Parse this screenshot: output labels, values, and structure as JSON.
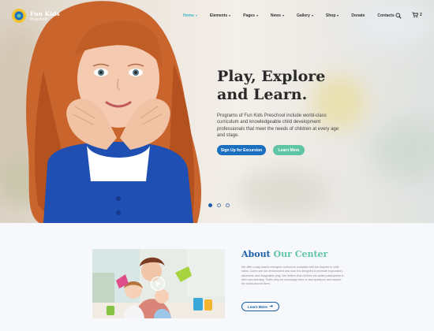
{
  "brand": {
    "name": "Fun Kids",
    "tagline": "Preschool"
  },
  "nav": {
    "items": [
      {
        "label": "Home",
        "dropdown": true,
        "active": true
      },
      {
        "label": "Elements",
        "dropdown": true
      },
      {
        "label": "Pages",
        "dropdown": true
      },
      {
        "label": "News",
        "dropdown": true
      },
      {
        "label": "Gallery",
        "dropdown": true
      },
      {
        "label": "Shop",
        "dropdown": true
      },
      {
        "label": "Donate",
        "dropdown": false
      },
      {
        "label": "Contacts",
        "dropdown": false
      }
    ],
    "search_icon": "search-icon",
    "cart_icon": "cart-icon",
    "cart_count": "2"
  },
  "hero": {
    "title": "Play, Explore and Learn.",
    "description": "Programs of Fun Kids Preschool include world-class curriculum and knowledgeable child development professionals that meet the needs of children at every age and stage.",
    "primary_button": "Sign Up for Excursion",
    "secondary_button": "Learn More",
    "slides": 3,
    "active_slide": 1
  },
  "about": {
    "title_part1": "About",
    "title_part2": "Our Center",
    "text": "We offer a play-based emergent curriculum complete with low teacher to child ratios. Come see our environment and how it is designed to promote exploration, adventure and imaginative play. We believe that children are active participants in their own learning. That's why we encourage them to ask questions and explore the world around them.",
    "button": "Learn More",
    "video_icon": "play-icon"
  },
  "colors": {
    "accent_blue": "#1b6fc1",
    "accent_green": "#5fc5a4",
    "nav_active": "#3fb7c4",
    "heading_dark": "#2a2a2a"
  }
}
